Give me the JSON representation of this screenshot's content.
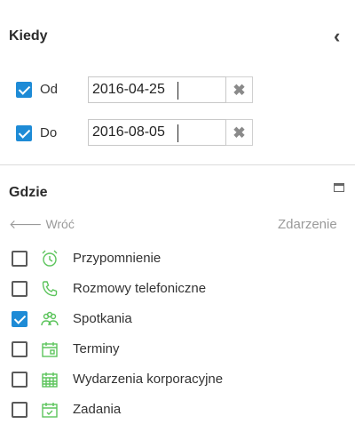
{
  "kiedy": {
    "title": "Kiedy",
    "od": {
      "label": "Od",
      "checked": true,
      "value": "2016-04-25"
    },
    "do": {
      "label": "Do",
      "checked": true,
      "value": "2016-08-05"
    },
    "clear_glyph": "✖",
    "collapse_glyph": "‹"
  },
  "gdzie": {
    "title": "Gdzie",
    "back_label": "Wróć",
    "back_glyph": "🡐",
    "category_label": "Zdarzenie",
    "items": [
      {
        "label": "Przypomnienie",
        "checked": false,
        "icon": "alarm-clock-icon"
      },
      {
        "label": "Rozmowy telefoniczne",
        "checked": false,
        "icon": "phone-icon"
      },
      {
        "label": "Spotkania",
        "checked": true,
        "icon": "people-icon"
      },
      {
        "label": "Terminy",
        "checked": false,
        "icon": "calendar-icon"
      },
      {
        "label": "Wydarzenia korporacyjne",
        "checked": false,
        "icon": "calendar-grid-icon"
      },
      {
        "label": "Zadania",
        "checked": false,
        "icon": "calendar-check-icon"
      }
    ]
  },
  "colors": {
    "accent": "#1e8bd6",
    "icon_green": "#5cc45c"
  }
}
